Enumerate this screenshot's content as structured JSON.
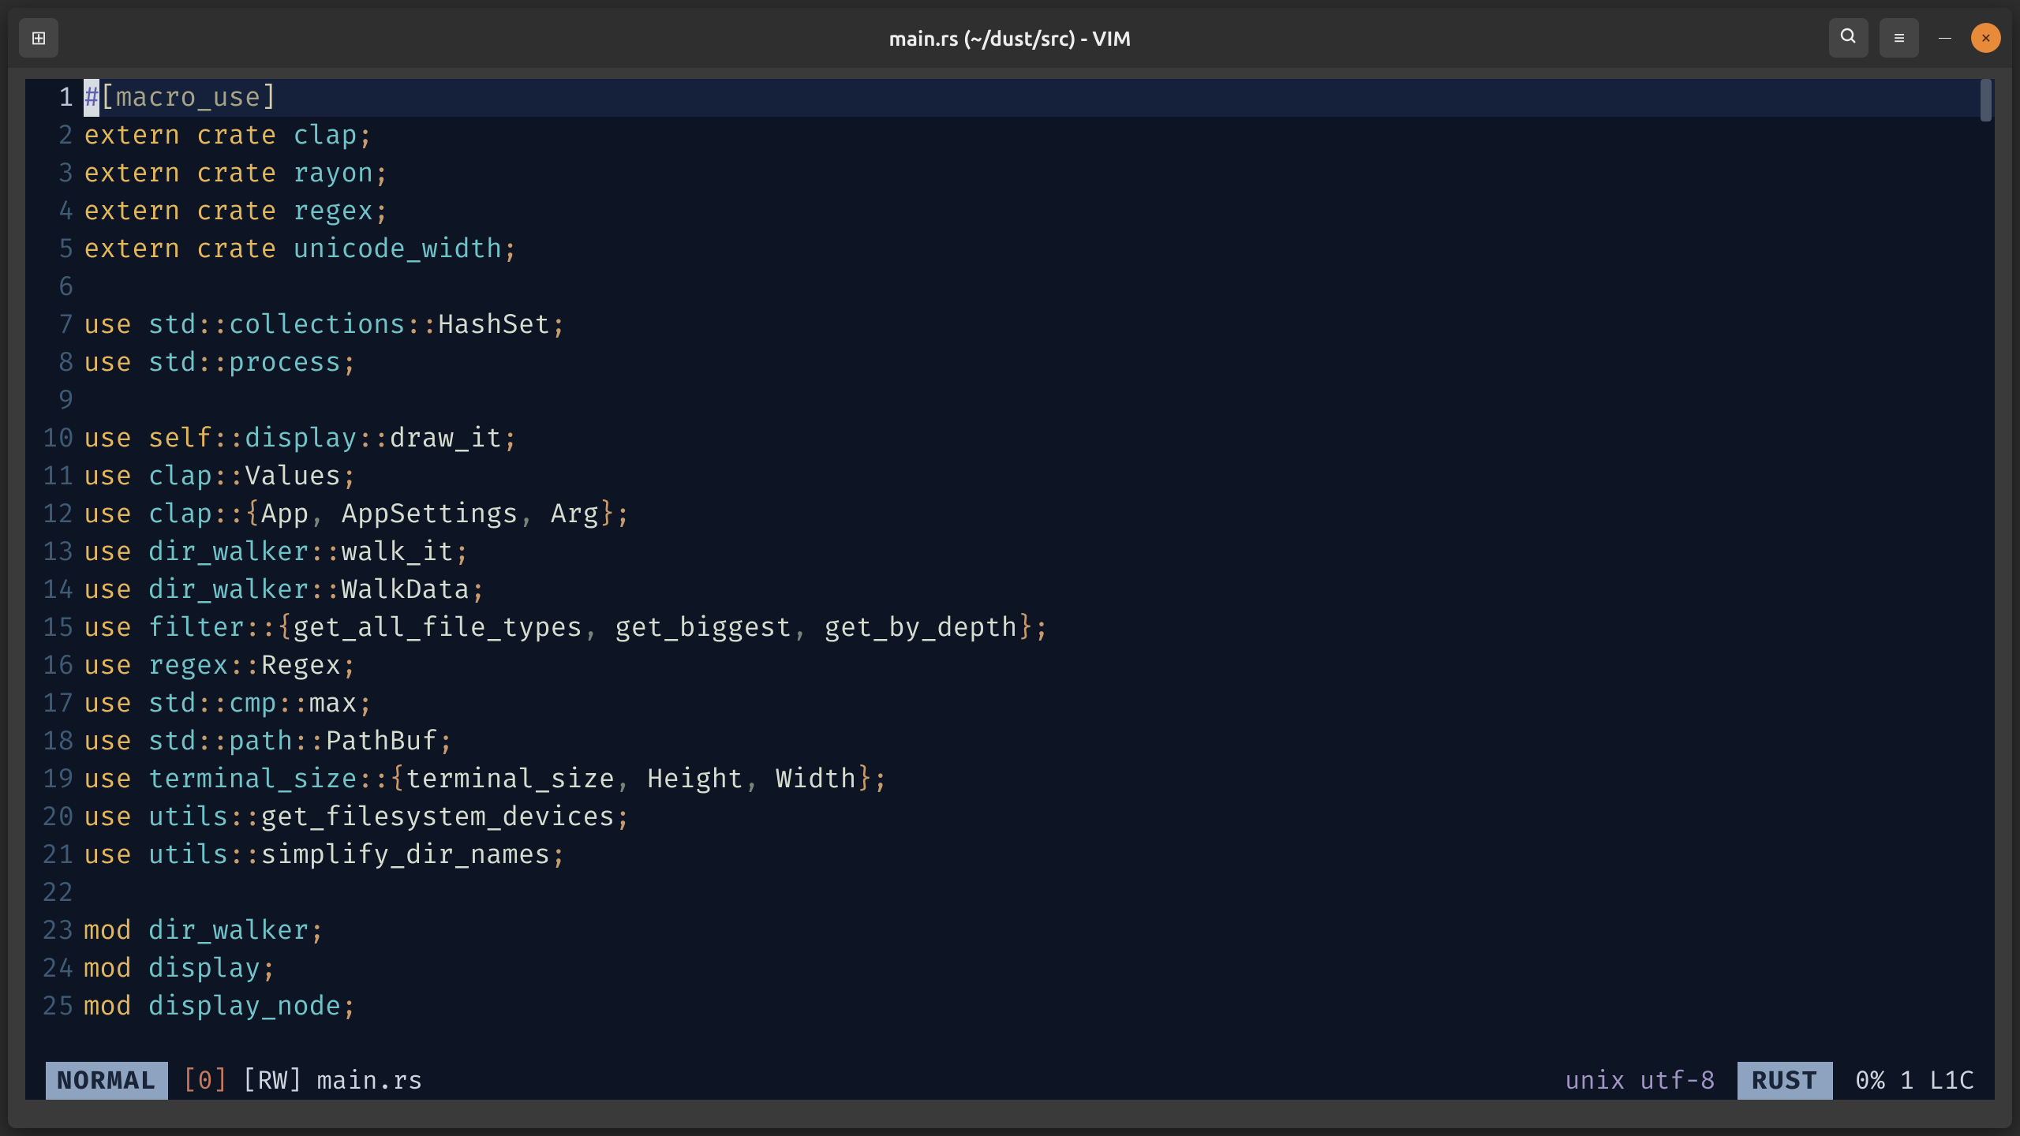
{
  "window": {
    "title": "main.rs (~/dust/src) - VIM"
  },
  "icons": {
    "new_tab": "⊞",
    "search": "🔍",
    "menu": "≡",
    "minimize": "—",
    "close": "✕"
  },
  "editor": {
    "cursor_char": "#",
    "lines": [
      {
        "n": 1,
        "tokens": [
          {
            "t": "[",
            "c": "attrb"
          },
          {
            "t": "macro_use",
            "c": "attr"
          },
          {
            "t": "]",
            "c": "attrb"
          }
        ],
        "cursor_before": true
      },
      {
        "n": 2,
        "tokens": [
          {
            "t": "extern crate",
            "c": "kw"
          },
          {
            "t": " "
          },
          {
            "t": "clap",
            "c": "crate"
          },
          {
            "t": ";",
            "c": "punct"
          }
        ]
      },
      {
        "n": 3,
        "tokens": [
          {
            "t": "extern crate",
            "c": "kw"
          },
          {
            "t": " "
          },
          {
            "t": "rayon",
            "c": "crate"
          },
          {
            "t": ";",
            "c": "punct"
          }
        ]
      },
      {
        "n": 4,
        "tokens": [
          {
            "t": "extern crate",
            "c": "kw"
          },
          {
            "t": " "
          },
          {
            "t": "regex",
            "c": "crate"
          },
          {
            "t": ";",
            "c": "punct"
          }
        ]
      },
      {
        "n": 5,
        "tokens": [
          {
            "t": "extern crate",
            "c": "kw"
          },
          {
            "t": " "
          },
          {
            "t": "unicode_width",
            "c": "crate"
          },
          {
            "t": ";",
            "c": "punct"
          }
        ]
      },
      {
        "n": 6,
        "tokens": []
      },
      {
        "n": 7,
        "tokens": [
          {
            "t": "use",
            "c": "kw"
          },
          {
            "t": " "
          },
          {
            "t": "std",
            "c": "crate"
          },
          {
            "t": "::",
            "c": "punct"
          },
          {
            "t": "collections",
            "c": "crate"
          },
          {
            "t": "::",
            "c": "punct"
          },
          {
            "t": "HashSet",
            "c": "ident"
          },
          {
            "t": ";",
            "c": "punct"
          }
        ]
      },
      {
        "n": 8,
        "tokens": [
          {
            "t": "use",
            "c": "kw"
          },
          {
            "t": " "
          },
          {
            "t": "std",
            "c": "crate"
          },
          {
            "t": "::",
            "c": "punct"
          },
          {
            "t": "process",
            "c": "crate"
          },
          {
            "t": ";",
            "c": "punct"
          }
        ]
      },
      {
        "n": 9,
        "tokens": []
      },
      {
        "n": 10,
        "tokens": [
          {
            "t": "use",
            "c": "kw"
          },
          {
            "t": " "
          },
          {
            "t": "self",
            "c": "kw"
          },
          {
            "t": "::",
            "c": "punct"
          },
          {
            "t": "display",
            "c": "crate"
          },
          {
            "t": "::",
            "c": "punct"
          },
          {
            "t": "draw_it",
            "c": "ident"
          },
          {
            "t": ";",
            "c": "punct"
          }
        ]
      },
      {
        "n": 11,
        "tokens": [
          {
            "t": "use",
            "c": "kw"
          },
          {
            "t": " "
          },
          {
            "t": "clap",
            "c": "crate"
          },
          {
            "t": "::",
            "c": "punct"
          },
          {
            "t": "Values",
            "c": "ident"
          },
          {
            "t": ";",
            "c": "punct"
          }
        ]
      },
      {
        "n": 12,
        "tokens": [
          {
            "t": "use",
            "c": "kw"
          },
          {
            "t": " "
          },
          {
            "t": "clap",
            "c": "crate"
          },
          {
            "t": "::",
            "c": "punct"
          },
          {
            "t": "{",
            "c": "punct"
          },
          {
            "t": "App",
            "c": "ident"
          },
          {
            "t": ", ",
            "c": "sep"
          },
          {
            "t": "AppSettings",
            "c": "ident"
          },
          {
            "t": ", ",
            "c": "sep"
          },
          {
            "t": "Arg",
            "c": "ident"
          },
          {
            "t": "}",
            "c": "punct"
          },
          {
            "t": ";",
            "c": "punct"
          }
        ]
      },
      {
        "n": 13,
        "tokens": [
          {
            "t": "use",
            "c": "kw"
          },
          {
            "t": " "
          },
          {
            "t": "dir_walker",
            "c": "crate"
          },
          {
            "t": "::",
            "c": "punct"
          },
          {
            "t": "walk_it",
            "c": "ident"
          },
          {
            "t": ";",
            "c": "punct"
          }
        ]
      },
      {
        "n": 14,
        "tokens": [
          {
            "t": "use",
            "c": "kw"
          },
          {
            "t": " "
          },
          {
            "t": "dir_walker",
            "c": "crate"
          },
          {
            "t": "::",
            "c": "punct"
          },
          {
            "t": "WalkData",
            "c": "ident"
          },
          {
            "t": ";",
            "c": "punct"
          }
        ]
      },
      {
        "n": 15,
        "tokens": [
          {
            "t": "use",
            "c": "kw"
          },
          {
            "t": " "
          },
          {
            "t": "filter",
            "c": "crate"
          },
          {
            "t": "::",
            "c": "punct"
          },
          {
            "t": "{",
            "c": "punct"
          },
          {
            "t": "get_all_file_types",
            "c": "ident"
          },
          {
            "t": ", ",
            "c": "sep"
          },
          {
            "t": "get_biggest",
            "c": "ident"
          },
          {
            "t": ", ",
            "c": "sep"
          },
          {
            "t": "get_by_depth",
            "c": "ident"
          },
          {
            "t": "}",
            "c": "punct"
          },
          {
            "t": ";",
            "c": "punct"
          }
        ]
      },
      {
        "n": 16,
        "tokens": [
          {
            "t": "use",
            "c": "kw"
          },
          {
            "t": " "
          },
          {
            "t": "regex",
            "c": "crate"
          },
          {
            "t": "::",
            "c": "punct"
          },
          {
            "t": "Regex",
            "c": "ident"
          },
          {
            "t": ";",
            "c": "punct"
          }
        ]
      },
      {
        "n": 17,
        "tokens": [
          {
            "t": "use",
            "c": "kw"
          },
          {
            "t": " "
          },
          {
            "t": "std",
            "c": "crate"
          },
          {
            "t": "::",
            "c": "punct"
          },
          {
            "t": "cmp",
            "c": "crate"
          },
          {
            "t": "::",
            "c": "punct"
          },
          {
            "t": "max",
            "c": "ident"
          },
          {
            "t": ";",
            "c": "punct"
          }
        ]
      },
      {
        "n": 18,
        "tokens": [
          {
            "t": "use",
            "c": "kw"
          },
          {
            "t": " "
          },
          {
            "t": "std",
            "c": "crate"
          },
          {
            "t": "::",
            "c": "punct"
          },
          {
            "t": "path",
            "c": "crate"
          },
          {
            "t": "::",
            "c": "punct"
          },
          {
            "t": "PathBuf",
            "c": "ident"
          },
          {
            "t": ";",
            "c": "punct"
          }
        ]
      },
      {
        "n": 19,
        "tokens": [
          {
            "t": "use",
            "c": "kw"
          },
          {
            "t": " "
          },
          {
            "t": "terminal_size",
            "c": "crate"
          },
          {
            "t": "::",
            "c": "punct"
          },
          {
            "t": "{",
            "c": "punct"
          },
          {
            "t": "terminal_size",
            "c": "ident"
          },
          {
            "t": ", ",
            "c": "sep"
          },
          {
            "t": "Height",
            "c": "ident"
          },
          {
            "t": ", ",
            "c": "sep"
          },
          {
            "t": "Width",
            "c": "ident"
          },
          {
            "t": "}",
            "c": "punct"
          },
          {
            "t": ";",
            "c": "punct"
          }
        ]
      },
      {
        "n": 20,
        "tokens": [
          {
            "t": "use",
            "c": "kw"
          },
          {
            "t": " "
          },
          {
            "t": "utils",
            "c": "crate"
          },
          {
            "t": "::",
            "c": "punct"
          },
          {
            "t": "get_filesystem_devices",
            "c": "ident"
          },
          {
            "t": ";",
            "c": "punct"
          }
        ]
      },
      {
        "n": 21,
        "tokens": [
          {
            "t": "use",
            "c": "kw"
          },
          {
            "t": " "
          },
          {
            "t": "utils",
            "c": "crate"
          },
          {
            "t": "::",
            "c": "punct"
          },
          {
            "t": "simplify_dir_names",
            "c": "ident"
          },
          {
            "t": ";",
            "c": "punct"
          }
        ]
      },
      {
        "n": 22,
        "tokens": []
      },
      {
        "n": 23,
        "tokens": [
          {
            "t": "mod",
            "c": "kw"
          },
          {
            "t": " "
          },
          {
            "t": "dir_walker",
            "c": "crate"
          },
          {
            "t": ";",
            "c": "punct"
          }
        ]
      },
      {
        "n": 24,
        "tokens": [
          {
            "t": "mod",
            "c": "kw"
          },
          {
            "t": " "
          },
          {
            "t": "display",
            "c": "crate"
          },
          {
            "t": ";",
            "c": "punct"
          }
        ]
      },
      {
        "n": 25,
        "tokens": [
          {
            "t": "mod",
            "c": "kw"
          },
          {
            "t": " "
          },
          {
            "t": "display_node",
            "c": "crate"
          },
          {
            "t": ";",
            "c": "punct"
          }
        ]
      }
    ]
  },
  "status": {
    "mode": "NORMAL",
    "buffer": "[0]",
    "rw": "[RW]",
    "filename": "main.rs",
    "format": "unix",
    "encoding": "utf-8",
    "lang": "RUST",
    "percent": "0%",
    "line": "1",
    "col": "L1C"
  }
}
